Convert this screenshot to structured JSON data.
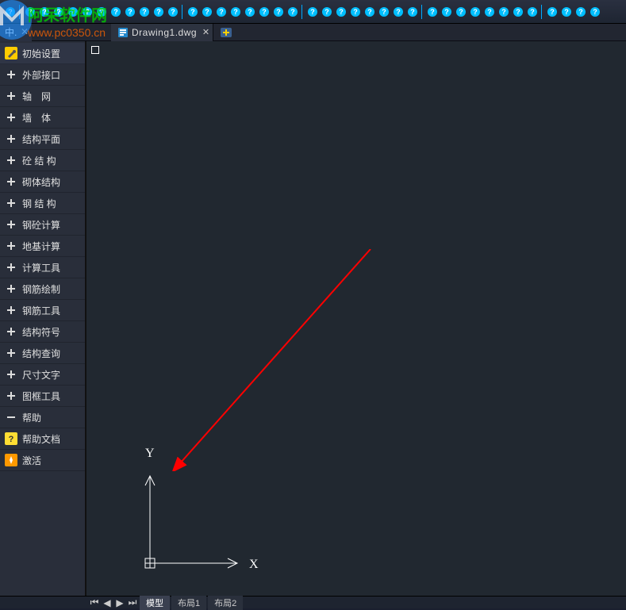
{
  "toolbar": {
    "left_label": "中."
  },
  "tab": {
    "filename": "Drawing1.dwg"
  },
  "sidebar": {
    "items": [
      {
        "label": "初始设置",
        "icon": "wrench-icon"
      },
      {
        "label": "外部接口",
        "icon": "plus-icon"
      },
      {
        "label": "轴　网",
        "icon": "plus-icon"
      },
      {
        "label": "墙　体",
        "icon": "plus-icon"
      },
      {
        "label": "结构平面",
        "icon": "plus-icon"
      },
      {
        "label": "砼 结 构",
        "icon": "plus-icon"
      },
      {
        "label": "砌体结构",
        "icon": "plus-icon"
      },
      {
        "label": "钢 结 构",
        "icon": "plus-icon"
      },
      {
        "label": "钢砼计算",
        "icon": "plus-icon"
      },
      {
        "label": "地基计算",
        "icon": "plus-icon"
      },
      {
        "label": "计算工具",
        "icon": "plus-icon"
      },
      {
        "label": "钢筋绘制",
        "icon": "plus-icon"
      },
      {
        "label": "钢筋工具",
        "icon": "plus-icon"
      },
      {
        "label": "结构符号",
        "icon": "plus-icon"
      },
      {
        "label": "结构查询",
        "icon": "plus-icon"
      },
      {
        "label": "尺寸文字",
        "icon": "plus-icon"
      },
      {
        "label": "图框工具",
        "icon": "plus-icon"
      },
      {
        "label": "帮助",
        "icon": "minus-icon"
      },
      {
        "label": "帮助文档",
        "icon": "help-doc-icon"
      },
      {
        "label": "激活",
        "icon": "activate-icon"
      }
    ]
  },
  "canvas": {
    "y_label": "Y",
    "x_label": "X"
  },
  "bottom": {
    "model": "模型",
    "layout1": "布局1",
    "layout2": "布局2"
  },
  "watermark": {
    "text1": "阿呆软件网",
    "text2": "www.pc0350.cn"
  }
}
